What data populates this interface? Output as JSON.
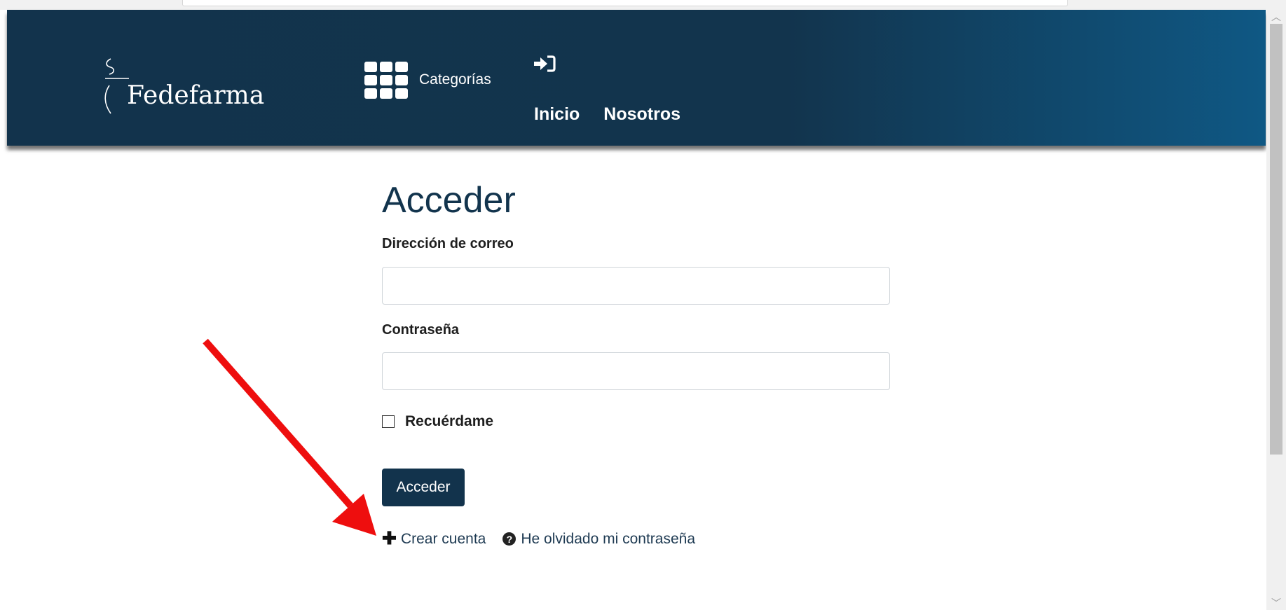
{
  "header": {
    "brand": "Fedefarma",
    "categories_label": "Categorías",
    "nav": [
      "Inicio",
      "Nosotros"
    ]
  },
  "form": {
    "title": "Acceder",
    "email_label": "Dirección de correo",
    "email_value": "",
    "password_label": "Contraseña",
    "password_value": "",
    "remember_label": "Recuérdame",
    "remember_checked": false,
    "submit_label": "Acceder",
    "create_account_label": "Crear cuenta",
    "forgot_password_label": "He olvidado mi contraseña"
  },
  "icons": {
    "brand_logo": "mortar-pestle-logo-icon",
    "categories": "grid-icon",
    "login": "sign-in-icon",
    "create_account": "plus-icon",
    "forgot_password": "question-circle-icon",
    "annotation": "red-arrow-icon"
  },
  "colors": {
    "navbar": "#12344d",
    "navbar_end": "#0f5884",
    "button": "#12334c",
    "title": "#12344d",
    "annotation_arrow": "#ee0e0e"
  }
}
